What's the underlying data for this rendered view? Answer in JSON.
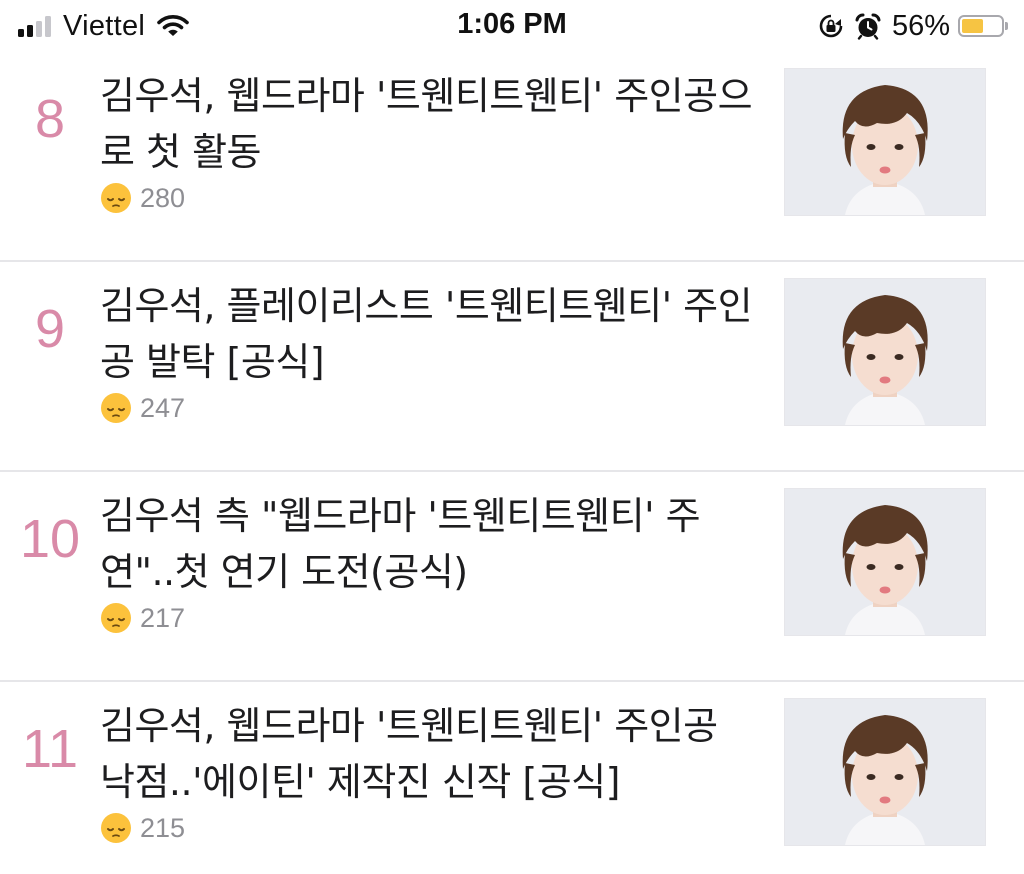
{
  "status_bar": {
    "carrier": "Viettel",
    "time": "1:06 PM",
    "battery_percent_text": "56%",
    "battery_level": 0.56,
    "signal_bars_active": 2,
    "signal_bars_total": 4,
    "icons": [
      "signal-icon",
      "wifi-icon",
      "rotation-lock-icon",
      "alarm-icon",
      "battery-icon"
    ]
  },
  "articles": [
    {
      "rank": "8",
      "title": "김우석, 웹드라마 '트웬티트웬티' 주인공으로 첫 활동",
      "reaction_icon": "sad-face-icon",
      "reaction_count": "280"
    },
    {
      "rank": "9",
      "title": "김우석, 플레이리스트 '트웬티트웬티' 주인공 발탁 [공식]",
      "reaction_icon": "sad-face-icon",
      "reaction_count": "247"
    },
    {
      "rank": "10",
      "title": "김우석 측 \"웹드라마 '트웬티트웬티' 주연\"..첫 연기 도전(공식)",
      "reaction_icon": "sad-face-icon",
      "reaction_count": "217"
    },
    {
      "rank": "11",
      "title": "김우석, 웹드라마 '트웬티트웬티' 주인공 낙점..'에이틴' 제작진 신작 [공식]",
      "reaction_icon": "sad-face-icon",
      "reaction_count": "215"
    }
  ],
  "colors": {
    "rank": "#d98aa8",
    "reaction_count": "#8e8e93",
    "battery_fill": "#f6c443",
    "divider": "#e6e6e9"
  }
}
